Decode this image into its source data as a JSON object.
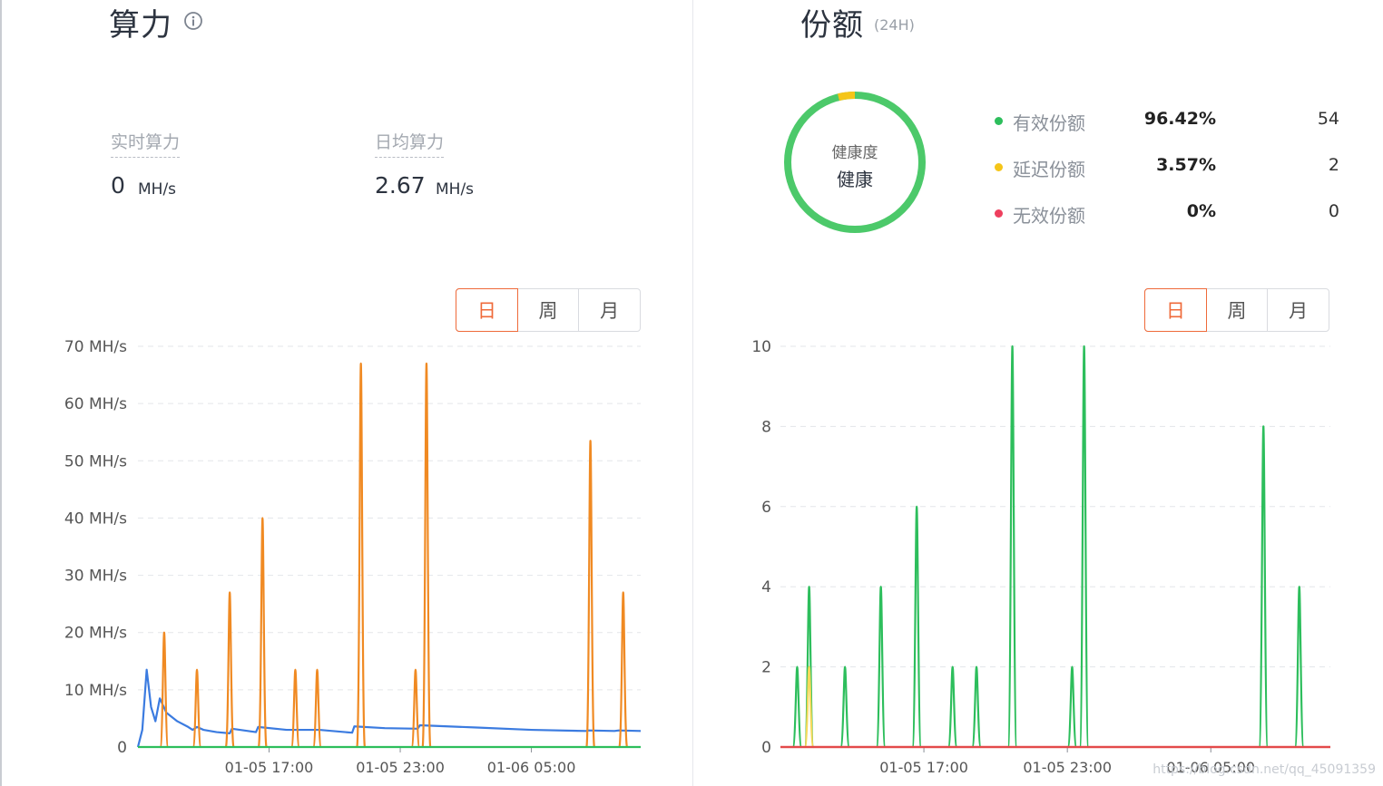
{
  "hashrate": {
    "title": "算力",
    "info_icon": "info-icon",
    "realtime_label": "实时算力",
    "realtime_value": "0",
    "realtime_unit": "MH/s",
    "avg_label": "日均算力",
    "avg_value": "2.67",
    "avg_unit": "MH/s",
    "tabs": [
      "日",
      "周",
      "月"
    ],
    "active_tab": "日"
  },
  "shares": {
    "title": "份额",
    "subtitle": "(24H)",
    "health_title": "健康度",
    "health_status": "健康",
    "rows": [
      {
        "name": "有效份额",
        "pct": "96.42%",
        "count": "54",
        "color": "#2dbe5c"
      },
      {
        "name": "延迟份额",
        "pct": "3.57%",
        "count": "2",
        "color": "#f5c518"
      },
      {
        "name": "无效份额",
        "pct": "0%",
        "count": "0",
        "color": "#ee3f5e"
      }
    ],
    "tabs": [
      "日",
      "周",
      "月"
    ],
    "active_tab": "日"
  },
  "watermark": "https://blog.csdn.net/qq_45091359",
  "chart_data": [
    {
      "type": "line",
      "y_ticks": [
        "0",
        "10 MH/s",
        "20 MH/s",
        "30 MH/s",
        "40 MH/s",
        "50 MH/s",
        "60 MH/s",
        "70 MH/s"
      ],
      "ylim": [
        0,
        70
      ],
      "x_tick_labels": [
        "01-05 17:00",
        "01-05 23:00",
        "01-06 05:00"
      ],
      "x_tick_hours": [
        6.0,
        12.0,
        18.0
      ],
      "xlim": [
        0,
        23.0
      ],
      "grid": true,
      "series": [
        {
          "color": "#3b7be0",
          "points": [
            [
              0.0,
              0
            ],
            [
              0.2,
              3
            ],
            [
              0.4,
              13.5
            ],
            [
              0.6,
              7
            ],
            [
              0.8,
              4.5
            ],
            [
              1.0,
              8.5
            ],
            [
              1.3,
              6
            ],
            [
              1.8,
              4.5
            ],
            [
              2.3,
              3.5
            ],
            [
              2.5,
              3
            ],
            [
              2.7,
              3.5
            ],
            [
              3.0,
              3
            ],
            [
              3.6,
              2.6
            ],
            [
              4.2,
              2.4
            ],
            [
              4.3,
              3.2
            ],
            [
              5.4,
              2.6
            ],
            [
              5.5,
              3.5
            ],
            [
              6.8,
              3
            ],
            [
              8.3,
              3
            ],
            [
              9.8,
              2.5
            ],
            [
              9.9,
              3.6
            ],
            [
              11.3,
              3.3
            ],
            [
              12.8,
              3.2
            ],
            [
              12.9,
              3.8
            ],
            [
              15.5,
              3.4
            ],
            [
              18.0,
              3
            ],
            [
              20.5,
              2.8
            ],
            [
              20.6,
              2.9
            ],
            [
              21.8,
              2.8
            ],
            [
              22.0,
              2.9
            ],
            [
              23.0,
              2.8
            ]
          ]
        },
        {
          "color": "#f08a23",
          "spikes": [
            [
              1.2,
              20
            ],
            [
              2.7,
              13.5
            ],
            [
              4.2,
              27
            ],
            [
              5.7,
              40
            ],
            [
              7.2,
              13.5
            ],
            [
              8.2,
              13.5
            ],
            [
              10.2,
              67
            ],
            [
              12.7,
              13.5
            ],
            [
              13.2,
              67
            ],
            [
              20.7,
              53.5
            ],
            [
              22.2,
              27
            ]
          ]
        },
        {
          "color": "#2dbe5c",
          "points": [
            [
              0.0,
              0
            ],
            [
              23.0,
              0
            ]
          ]
        }
      ]
    },
    {
      "type": "line",
      "y_ticks": [
        "0",
        "2",
        "4",
        "6",
        "8",
        "10"
      ],
      "ylim": [
        0,
        10
      ],
      "x_tick_labels": [
        "01-05 17:00",
        "01-05 23:00",
        "01-06 05:00"
      ],
      "x_tick_hours": [
        6.0,
        12.0,
        18.0
      ],
      "xlim": [
        0,
        23.0
      ],
      "grid": true,
      "series": [
        {
          "color": "#2dbe5c",
          "spikes": [
            [
              0.7,
              2
            ],
            [
              1.2,
              4
            ],
            [
              2.7,
              2
            ],
            [
              4.2,
              4
            ],
            [
              5.7,
              6
            ],
            [
              7.2,
              2
            ],
            [
              8.2,
              2
            ],
            [
              9.7,
              10
            ],
            [
              12.2,
              2
            ],
            [
              12.7,
              10
            ],
            [
              20.2,
              8
            ],
            [
              21.7,
              4
            ]
          ]
        },
        {
          "color": "#f5d95a",
          "spikes": [
            [
              1.2,
              2
            ]
          ]
        },
        {
          "color": "#e34a4a",
          "points": [
            [
              0.0,
              0
            ],
            [
              23.0,
              0
            ]
          ]
        }
      ]
    }
  ]
}
